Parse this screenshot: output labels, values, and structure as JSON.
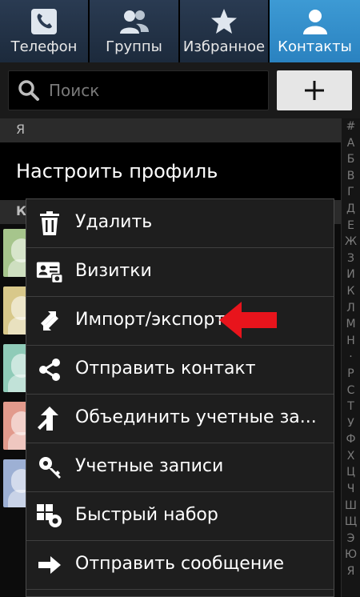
{
  "tabs": [
    {
      "label": "Телефон",
      "icon": "phone-icon",
      "active": false
    },
    {
      "label": "Группы",
      "icon": "groups-icon",
      "active": false
    },
    {
      "label": "Избранное",
      "icon": "star-icon",
      "active": false
    },
    {
      "label": "Контакты",
      "icon": "contact-icon",
      "active": true
    }
  ],
  "search": {
    "placeholder": "Поиск"
  },
  "list": {
    "section_me": "Я",
    "profile_label": "Настроить профиль",
    "section_k": "К"
  },
  "index_letters": [
    "#",
    "А",
    "Б",
    "В",
    "Г",
    "Д",
    "Е",
    "Ж",
    "З",
    "И",
    "К",
    "Л",
    "М",
    "Н",
    "·",
    "Р",
    "С",
    "Т",
    "У",
    "Ф",
    "Х",
    "Ц",
    "Ч",
    "Ш",
    "Щ",
    "Э",
    "Ю",
    "Я"
  ],
  "menu": [
    {
      "label": "Удалить",
      "icon": "trash-icon"
    },
    {
      "label": "Визитки",
      "icon": "business-card-icon"
    },
    {
      "label": "Импорт/экспорт",
      "icon": "import-export-icon"
    },
    {
      "label": "Отправить контакт",
      "icon": "share-icon"
    },
    {
      "label": "Объединить учетные за...",
      "icon": "merge-icon"
    },
    {
      "label": "Учетные записи",
      "icon": "key-icon"
    },
    {
      "label": "Быстрый набор",
      "icon": "speed-dial-icon"
    },
    {
      "label": "Отправить сообщение",
      "icon": "send-arrow-icon"
    }
  ],
  "colors": {
    "active_tab": "#3d9ad4",
    "inactive_tab": "#2a3b52",
    "annotation_arrow": "#e8141c"
  }
}
